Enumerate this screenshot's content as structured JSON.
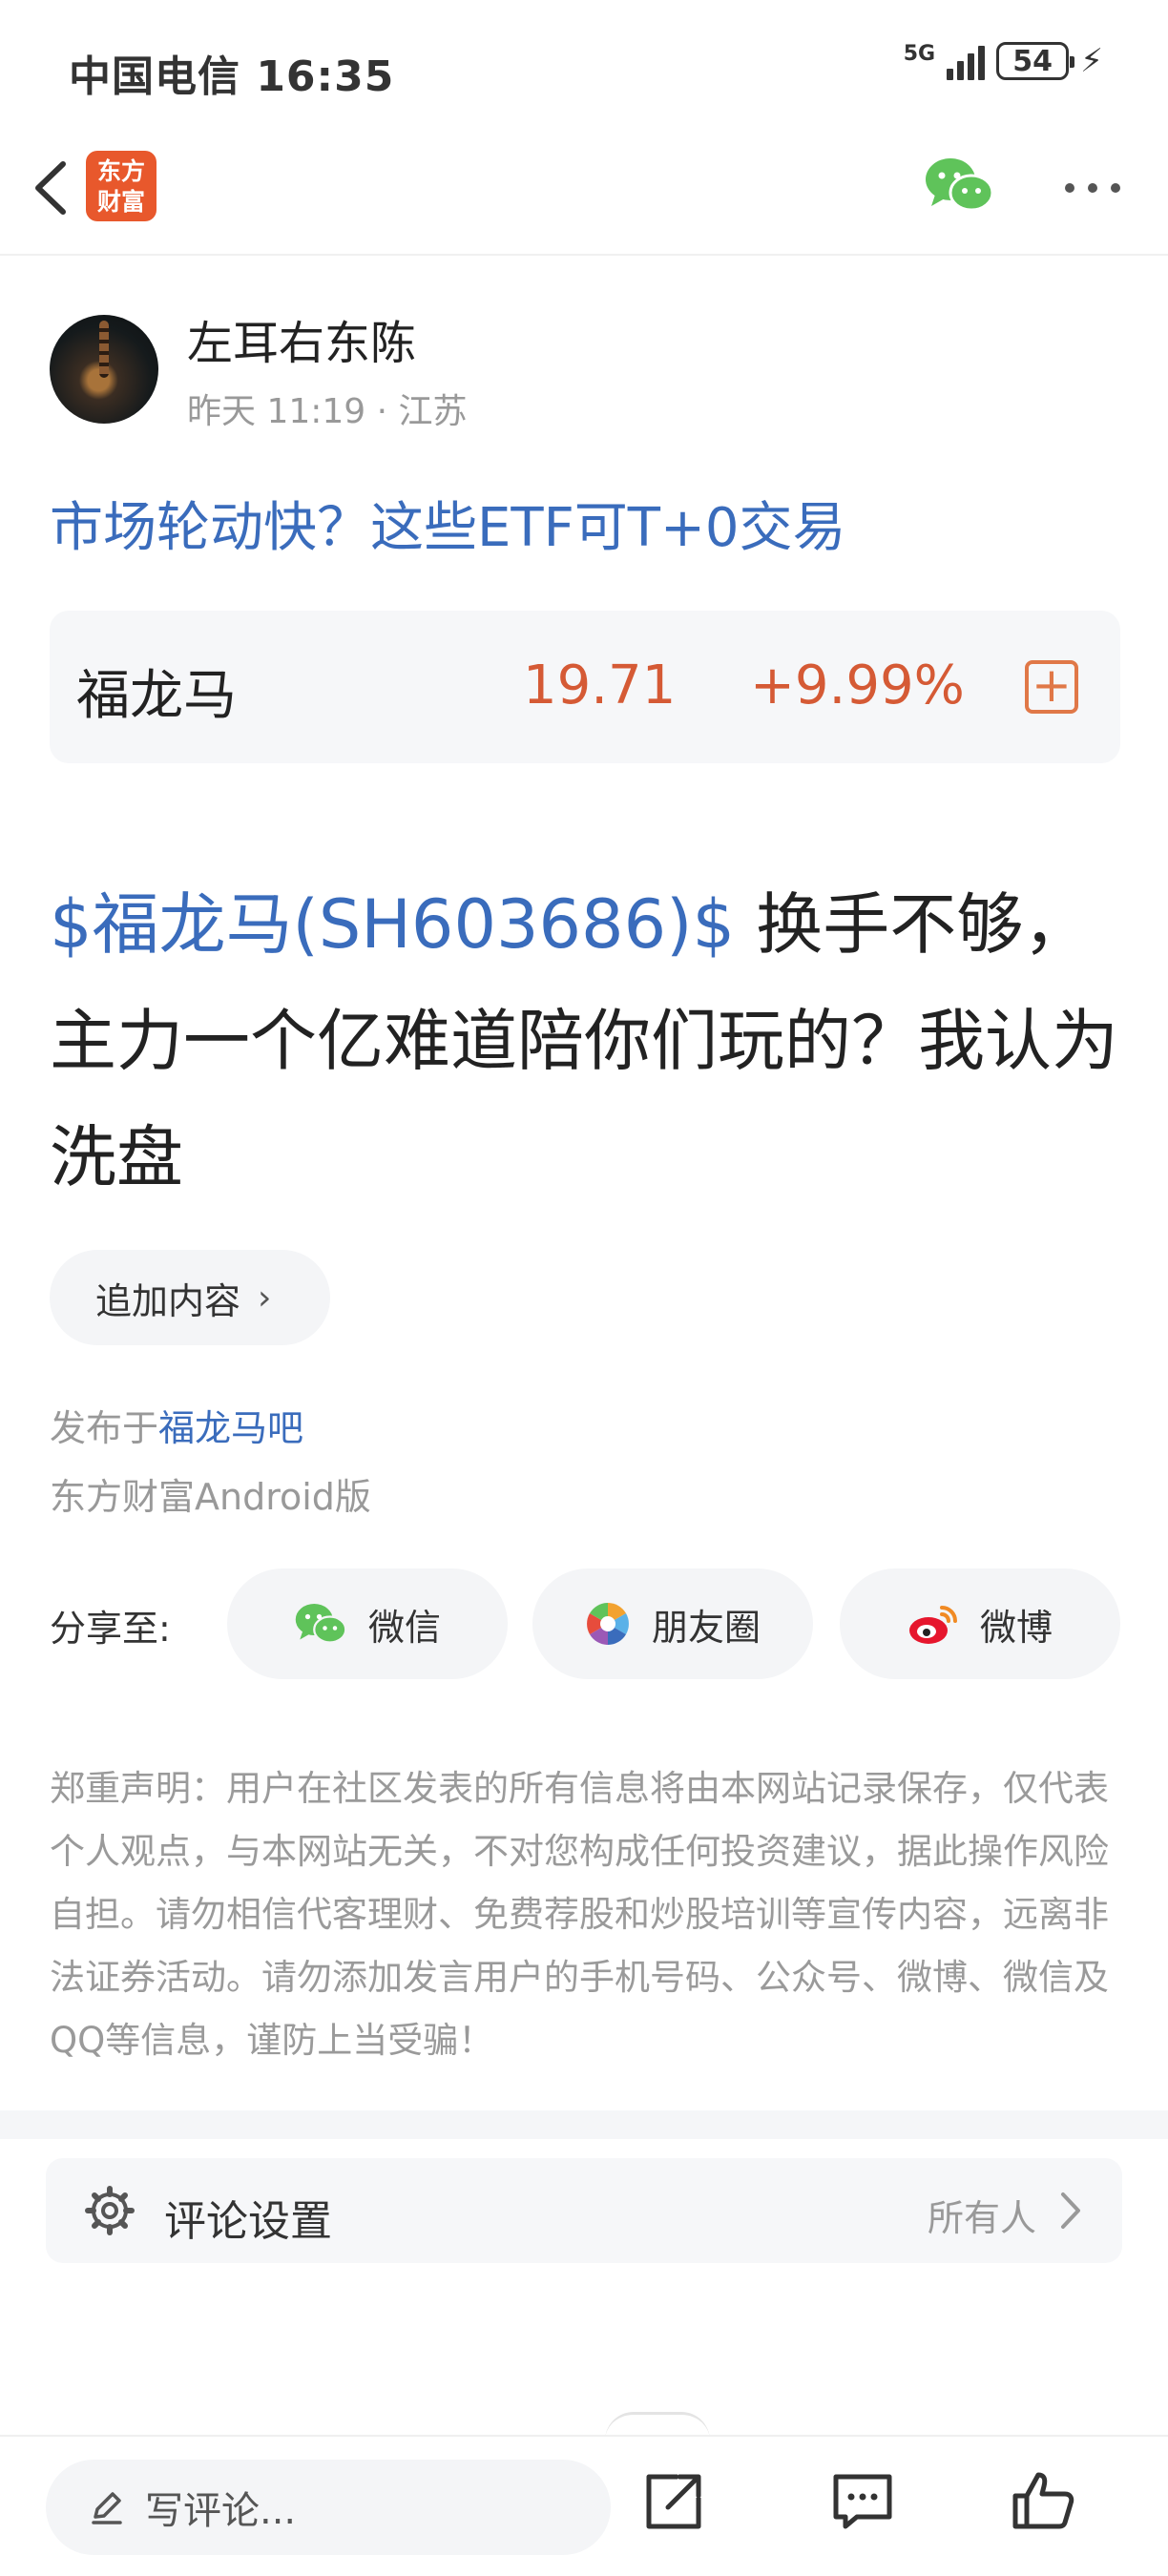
{
  "status_bar": {
    "carrier_time": "中国电信 16:35",
    "network": "5G",
    "battery": "54"
  },
  "nav": {
    "app_logo_text": "东方财富",
    "brand_color": "#e8582c"
  },
  "author": {
    "name": "左耳右东陈",
    "meta": "昨天 11:19 · 江苏"
  },
  "post": {
    "title": "市场轮动快？这些ETF可T+0交易",
    "stock_card": {
      "name": "福龙马",
      "price": "19.71",
      "change": "+9.99%",
      "color": "#d55a35"
    },
    "stock_tag": "$福龙马(SH603686)$",
    "body": " 换手不够，主力一个亿难道陪你们玩的？我认为洗盘",
    "append_label": "追加内容",
    "published_prefix": "发布于",
    "published_bar": "福龙马吧",
    "client": "东方财富Android版"
  },
  "share": {
    "label": "分享至:",
    "wechat": "微信",
    "moments": "朋友圈",
    "weibo": "微博"
  },
  "disclaimer": "郑重声明：用户在社区发表的所有信息将由本网站记录保存，仅代表个人观点，与本网站无关，不对您构成任何投资建议，据此操作风险自担。请勿相信代客理财、免费荐股和炒股培训等宣传内容，远离非法证券活动。请勿添加发言用户的手机号码、公众号、微博、微信及QQ等信息，谨防上当受骗！",
  "comment_settings": {
    "label": "评论设置",
    "value": "所有人"
  },
  "bottom_bar": {
    "comment_placeholder": "写评论..."
  },
  "colors": {
    "link_blue": "#3a6cbc",
    "wechat_green": "#5fc35a"
  }
}
